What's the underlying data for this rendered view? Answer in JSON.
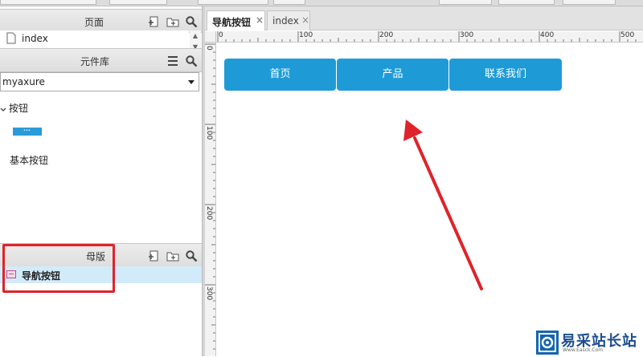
{
  "left_panel": {
    "pages": {
      "title": "页面",
      "items": [
        {
          "label": "index"
        }
      ]
    },
    "library": {
      "title": "元件库",
      "selected_library": "myaxure",
      "category": "按钮",
      "widgets": [
        {
          "label": "基本按钮"
        }
      ]
    },
    "masters": {
      "title": "母版",
      "items": [
        {
          "label": "导航按钮"
        }
      ]
    }
  },
  "tabs": [
    {
      "label": "导航按钮",
      "close": "×",
      "active": true
    },
    {
      "label": "index",
      "close": "×",
      "active": false
    }
  ],
  "ruler": {
    "h_ticks": [
      "0",
      "100",
      "200",
      "300",
      "400",
      "500"
    ],
    "v_ticks": [
      "0",
      "100",
      "200",
      "300"
    ]
  },
  "canvas": {
    "nav_buttons": [
      {
        "label": "首页"
      },
      {
        "label": "产品"
      },
      {
        "label": "联系我们"
      }
    ]
  },
  "watermark": {
    "title": "易采站长站",
    "url": "Www.Easck.Com"
  },
  "colors": {
    "nav_button": "#1e9bd7",
    "annotation_red": "#e0222a",
    "selected_row": "#d2ebfa"
  }
}
